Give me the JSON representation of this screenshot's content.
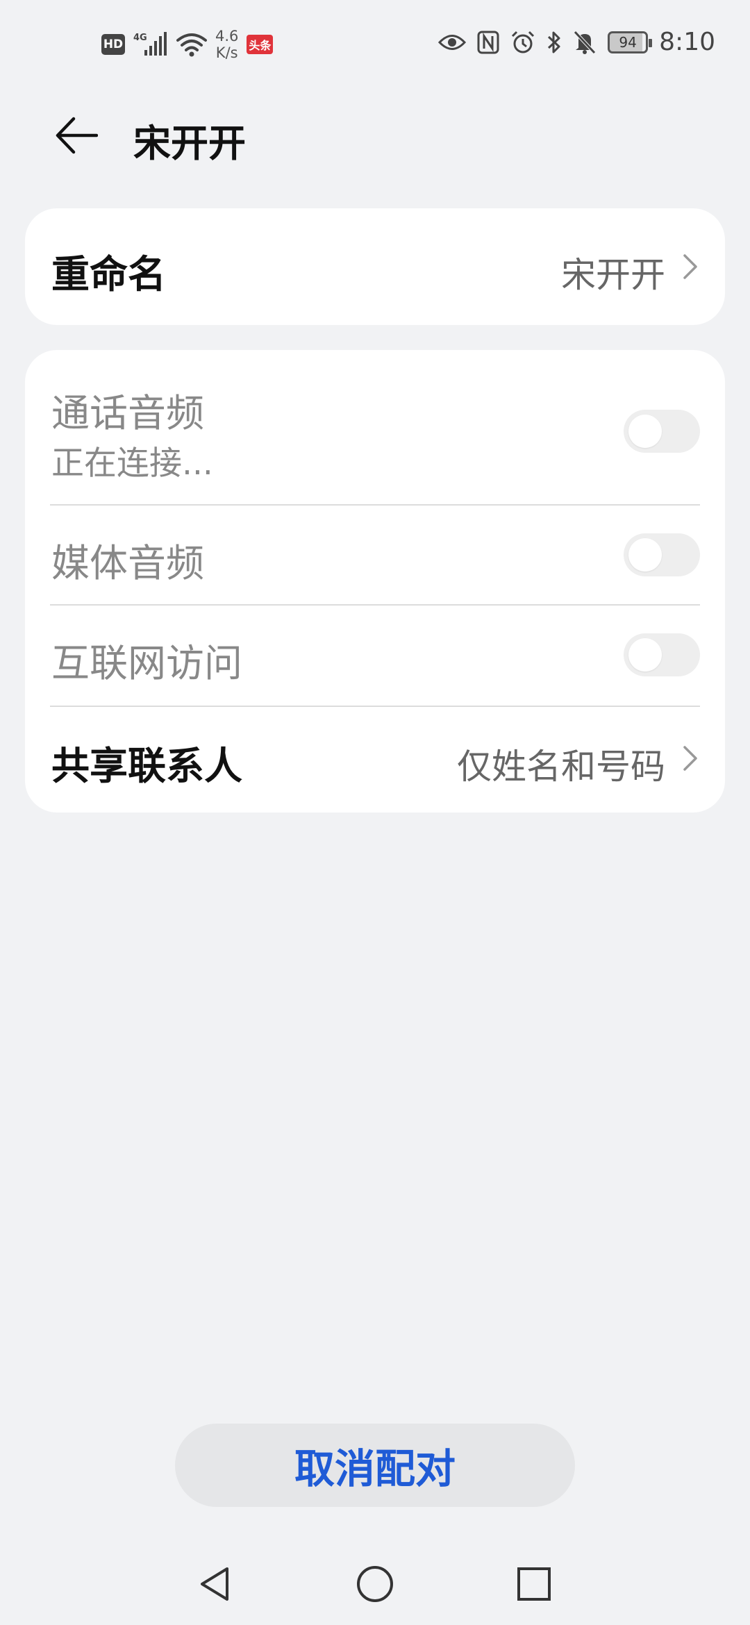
{
  "status_bar": {
    "hd": "HD",
    "network": "4G",
    "speed_value": "4.6",
    "speed_unit": "K/s",
    "news_badge": "头条",
    "battery": "94",
    "time": "8:10",
    "icons": [
      "hd-icon",
      "signal-icon",
      "wifi-icon",
      "eye-icon",
      "nfc-icon",
      "alarm-icon",
      "bluetooth-icon",
      "mute-icon",
      "battery-icon"
    ]
  },
  "header": {
    "title": "宋开开",
    "back_icon": "back-arrow-icon"
  },
  "rename": {
    "label": "重命名",
    "value": "宋开开"
  },
  "settings": {
    "call_audio": {
      "label": "通话音频",
      "status": "正在连接...",
      "enabled": false
    },
    "media_audio": {
      "label": "媒体音频",
      "enabled": false
    },
    "internet_access": {
      "label": "互联网访问",
      "enabled": false
    },
    "share_contacts": {
      "label": "共享联系人",
      "value": "仅姓名和号码"
    }
  },
  "unpair_button": "取消配对",
  "nav_bar": {
    "icons": [
      "nav-back-icon",
      "nav-home-icon",
      "nav-recents-icon"
    ]
  },
  "colors": {
    "background": "#f1f2f4",
    "card": "#ffffff",
    "accent": "#1f5bd6",
    "muted_text": "#888888"
  }
}
